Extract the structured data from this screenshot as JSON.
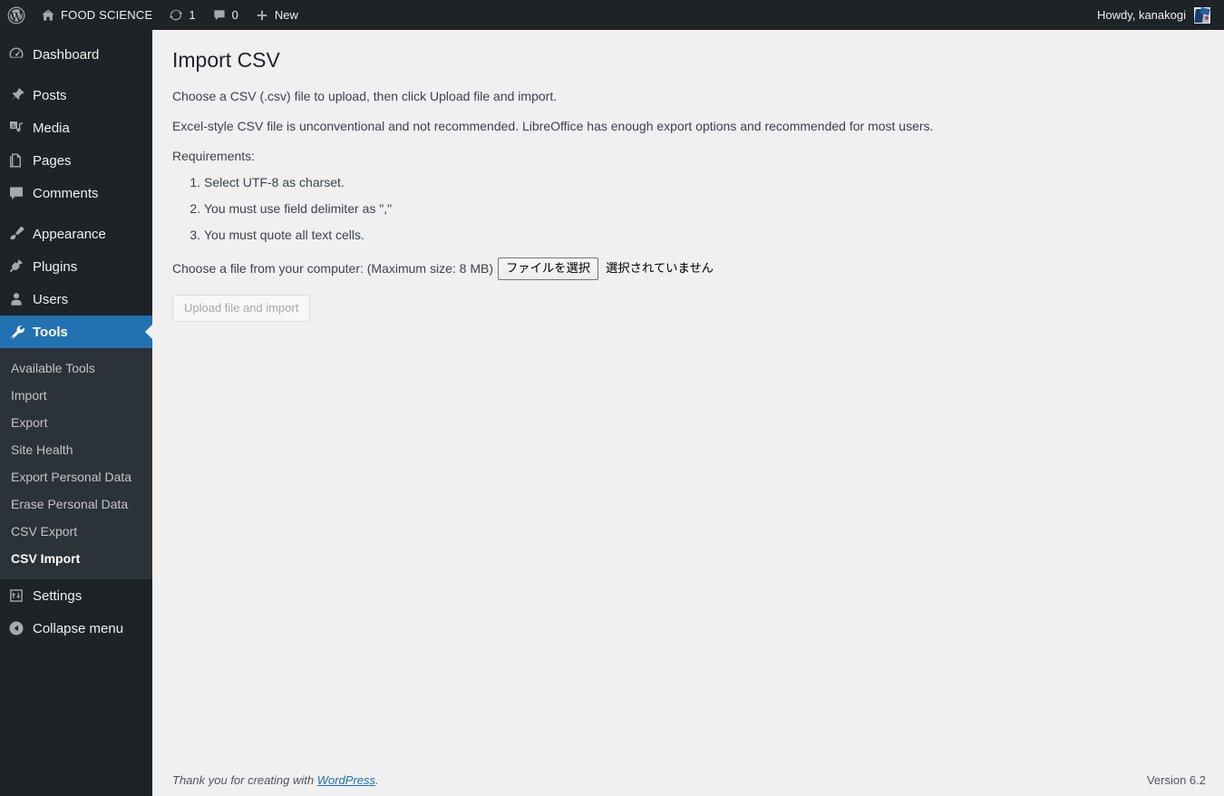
{
  "adminbar": {
    "logo_icon": "wordpress-logo-icon",
    "site": {
      "icon": "home-icon",
      "name": "FOOD SCIENCE"
    },
    "updates": {
      "icon": "updates-icon",
      "count": "1"
    },
    "comments": {
      "icon": "comment-bubble-icon",
      "count": "0"
    },
    "new": {
      "icon": "plus-icon",
      "label": "New"
    },
    "account": {
      "greeting": "Howdy, kanakogi",
      "avatar_icon": "user-avatar-image"
    }
  },
  "sidebar": {
    "items": [
      {
        "label": "Dashboard",
        "icon": "dashboard-icon",
        "current": false
      },
      {
        "label": "Posts",
        "icon": "pin-icon",
        "current": false
      },
      {
        "label": "Media",
        "icon": "media-icon",
        "current": false
      },
      {
        "label": "Pages",
        "icon": "pages-icon",
        "current": false
      },
      {
        "label": "Comments",
        "icon": "comment-bubble-icon",
        "current": false
      },
      {
        "label": "Appearance",
        "icon": "paintbrush-icon",
        "current": false
      },
      {
        "label": "Plugins",
        "icon": "plug-icon",
        "current": false
      },
      {
        "label": "Users",
        "icon": "user-icon",
        "current": false
      },
      {
        "label": "Tools",
        "icon": "wrench-icon",
        "current": true
      },
      {
        "label": "Settings",
        "icon": "settings-sliders-icon",
        "current": false
      }
    ],
    "submenu": [
      {
        "label": "Available Tools",
        "current": false
      },
      {
        "label": "Import",
        "current": false
      },
      {
        "label": "Export",
        "current": false
      },
      {
        "label": "Site Health",
        "current": false
      },
      {
        "label": "Export Personal Data",
        "current": false
      },
      {
        "label": "Erase Personal Data",
        "current": false
      },
      {
        "label": "CSV Export",
        "current": false
      },
      {
        "label": "CSV Import",
        "current": true
      }
    ],
    "collapse": {
      "label": "Collapse menu",
      "icon": "chevron-left-circle-icon"
    },
    "accent_color": "#2271b1",
    "background_color": "#1d2327",
    "submenu_background_color": "#2c3338"
  },
  "main": {
    "title": "Import CSV",
    "intro": "Choose a CSV (.csv) file to upload, then click Upload file and import.",
    "note": "Excel-style CSV file is unconventional and not recommended. LibreOffice has enough export options and recommended for most users.",
    "requirements_heading": "Requirements:",
    "requirements": [
      "Select UTF-8 as charset.",
      "You must use field delimiter as \",\"",
      "You must quote all text cells."
    ],
    "file_label": "Choose a file from your computer: (Maximum size: 8 MB)",
    "file_button_label": "ファイルを選択",
    "file_status": "選択されていません",
    "submit_label": "Upload file and import"
  },
  "footer": {
    "thanks_prefix": "Thank you for creating with ",
    "thanks_link": "WordPress",
    "thanks_suffix": ".",
    "version": "Version 6.2"
  }
}
